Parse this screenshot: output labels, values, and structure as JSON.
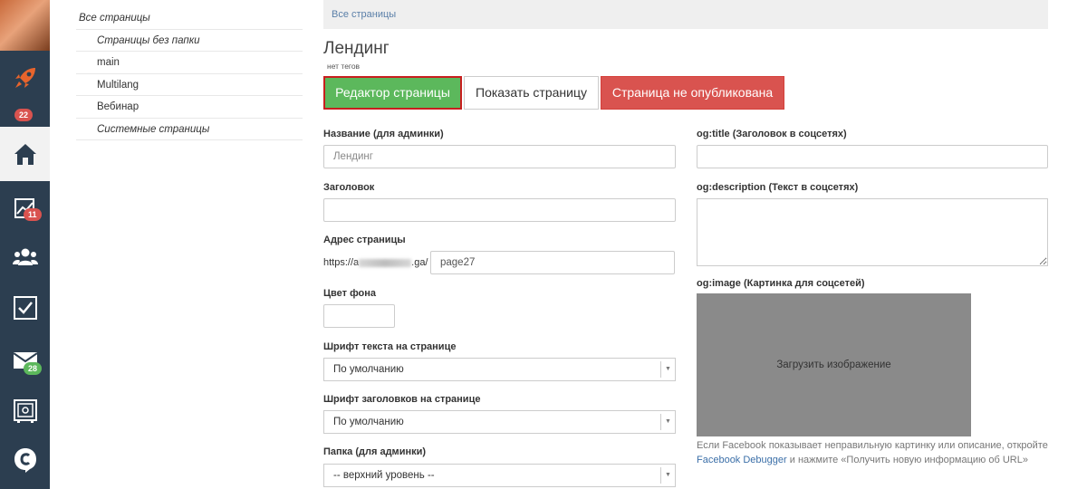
{
  "sidebar_rail": {
    "items": [
      {
        "name": "rocket-icon"
      },
      {
        "name": "home-icon",
        "badge": "22",
        "active": true
      },
      {
        "name": "chart-icon",
        "badge": "11"
      },
      {
        "name": "users-icon"
      },
      {
        "name": "tasks-icon"
      },
      {
        "name": "mail-icon",
        "badge": "28"
      },
      {
        "name": "safe-icon"
      },
      {
        "name": "logo-c-icon"
      }
    ],
    "colors": {
      "rail_bg": "#2c3e50",
      "badge_red": "#d9534f",
      "badge_green": "#5cb85c"
    }
  },
  "folders": {
    "items": [
      {
        "label": "Все страницы"
      },
      {
        "label": "Страницы без папки"
      },
      {
        "label": "main"
      },
      {
        "label": "Multilang"
      },
      {
        "label": "Вебинар"
      },
      {
        "label": "Системные страницы"
      }
    ]
  },
  "breadcrumb": {
    "text": "Все страницы"
  },
  "page": {
    "title": "Лендинг",
    "tags": "нет тегов"
  },
  "buttons": {
    "editor": "Редактор страницы",
    "show": "Показать страницу",
    "unpublished": "Страница не опубликована"
  },
  "form": {
    "name_label": "Название (для админки)",
    "name_placeholder": "Лендинг",
    "heading_label": "Заголовок",
    "heading_value": "",
    "address_label": "Адрес страницы",
    "address_prefix_start": "https://a",
    "address_prefix_end": ".ga/",
    "address_value": "page27",
    "bg_color_label": "Цвет фона",
    "text_font_label": "Шрифт текста на странице",
    "text_font_value": "По умолчанию",
    "heading_font_label": "Шрифт заголовков на странице",
    "heading_font_value": "По умолчанию",
    "folder_label": "Папка (для админки)",
    "folder_value": "-- верхний уровень --"
  },
  "social": {
    "og_title_label": "og:title (Заголовок в соцсетях)",
    "og_description_label": "og:description (Текст в соцсетях)",
    "og_image_label": "og:image (Картинка для соцсетей)",
    "upload_text": "Загрузить изображение",
    "fb_note_start": "Если Facebook показывает неправильную картинку или описание, откройте",
    "fb_link": "Facebook Debugger",
    "fb_note_end": "и нажмите «Получить новую информацию об URL»"
  },
  "colors": {
    "accent_green": "#5cb85c",
    "accent_red": "#d9534f",
    "link_blue": "#3b6fa8"
  }
}
